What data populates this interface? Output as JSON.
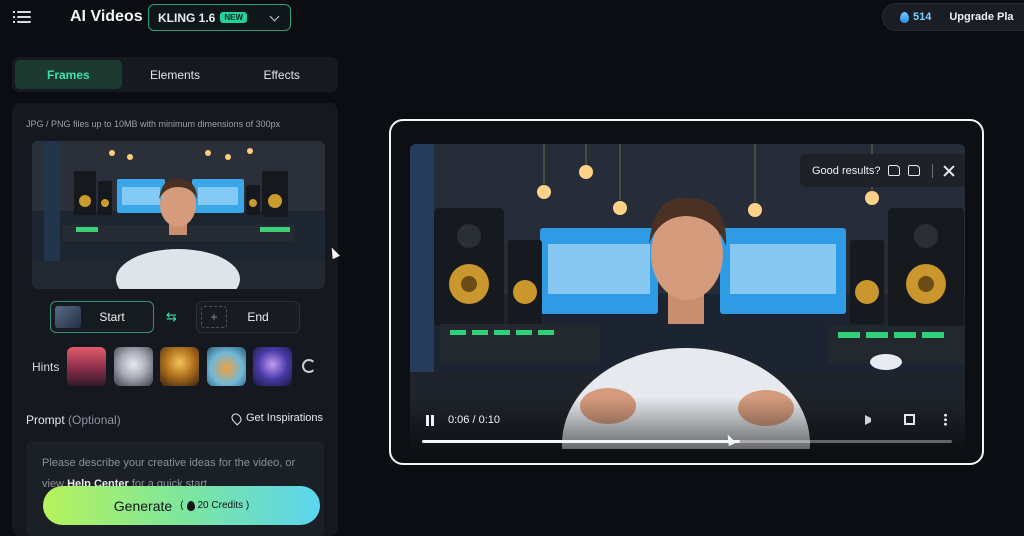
{
  "header": {
    "title": "AI Videos",
    "model": {
      "name": "KLING 1.6",
      "badge": "NEW"
    },
    "credits": "514",
    "upgrade_label": "Upgrade Pla"
  },
  "tabs": [
    {
      "label": "Frames",
      "active": true
    },
    {
      "label": "Elements",
      "active": false
    },
    {
      "label": "Effects",
      "active": false
    }
  ],
  "frames": {
    "upload_hint": "JPG / PNG files up to 10MB with minimum dimensions of 300px",
    "start_label": "Start",
    "end_label": "End"
  },
  "hints": {
    "label": "Hints",
    "thumbnails": [
      "sunset-landscape",
      "stone-sculpture",
      "golden-deity",
      "cat-in-bowl",
      "cosmic-portrait"
    ]
  },
  "prompt": {
    "label": "Prompt",
    "optional": "(Optional)",
    "inspiration_label": "Get Inspirations",
    "placeholder_part1": "Please describe your creative ideas for the video, or view ",
    "help_link": "Help Center",
    "placeholder_part2": " for a quick start"
  },
  "generate": {
    "label": "Generate",
    "credits": "20",
    "credits_suffix": "Credits"
  },
  "video": {
    "feedback_label": "Good results?",
    "time": "0:06 / 0:10",
    "progress": 0.6
  },
  "colors": {
    "accent": "#3fe0a8",
    "new_badge": "#22d39a",
    "generate_gradient": [
      "#b7f25c",
      "#7ee69b",
      "#5ad6ef"
    ]
  }
}
